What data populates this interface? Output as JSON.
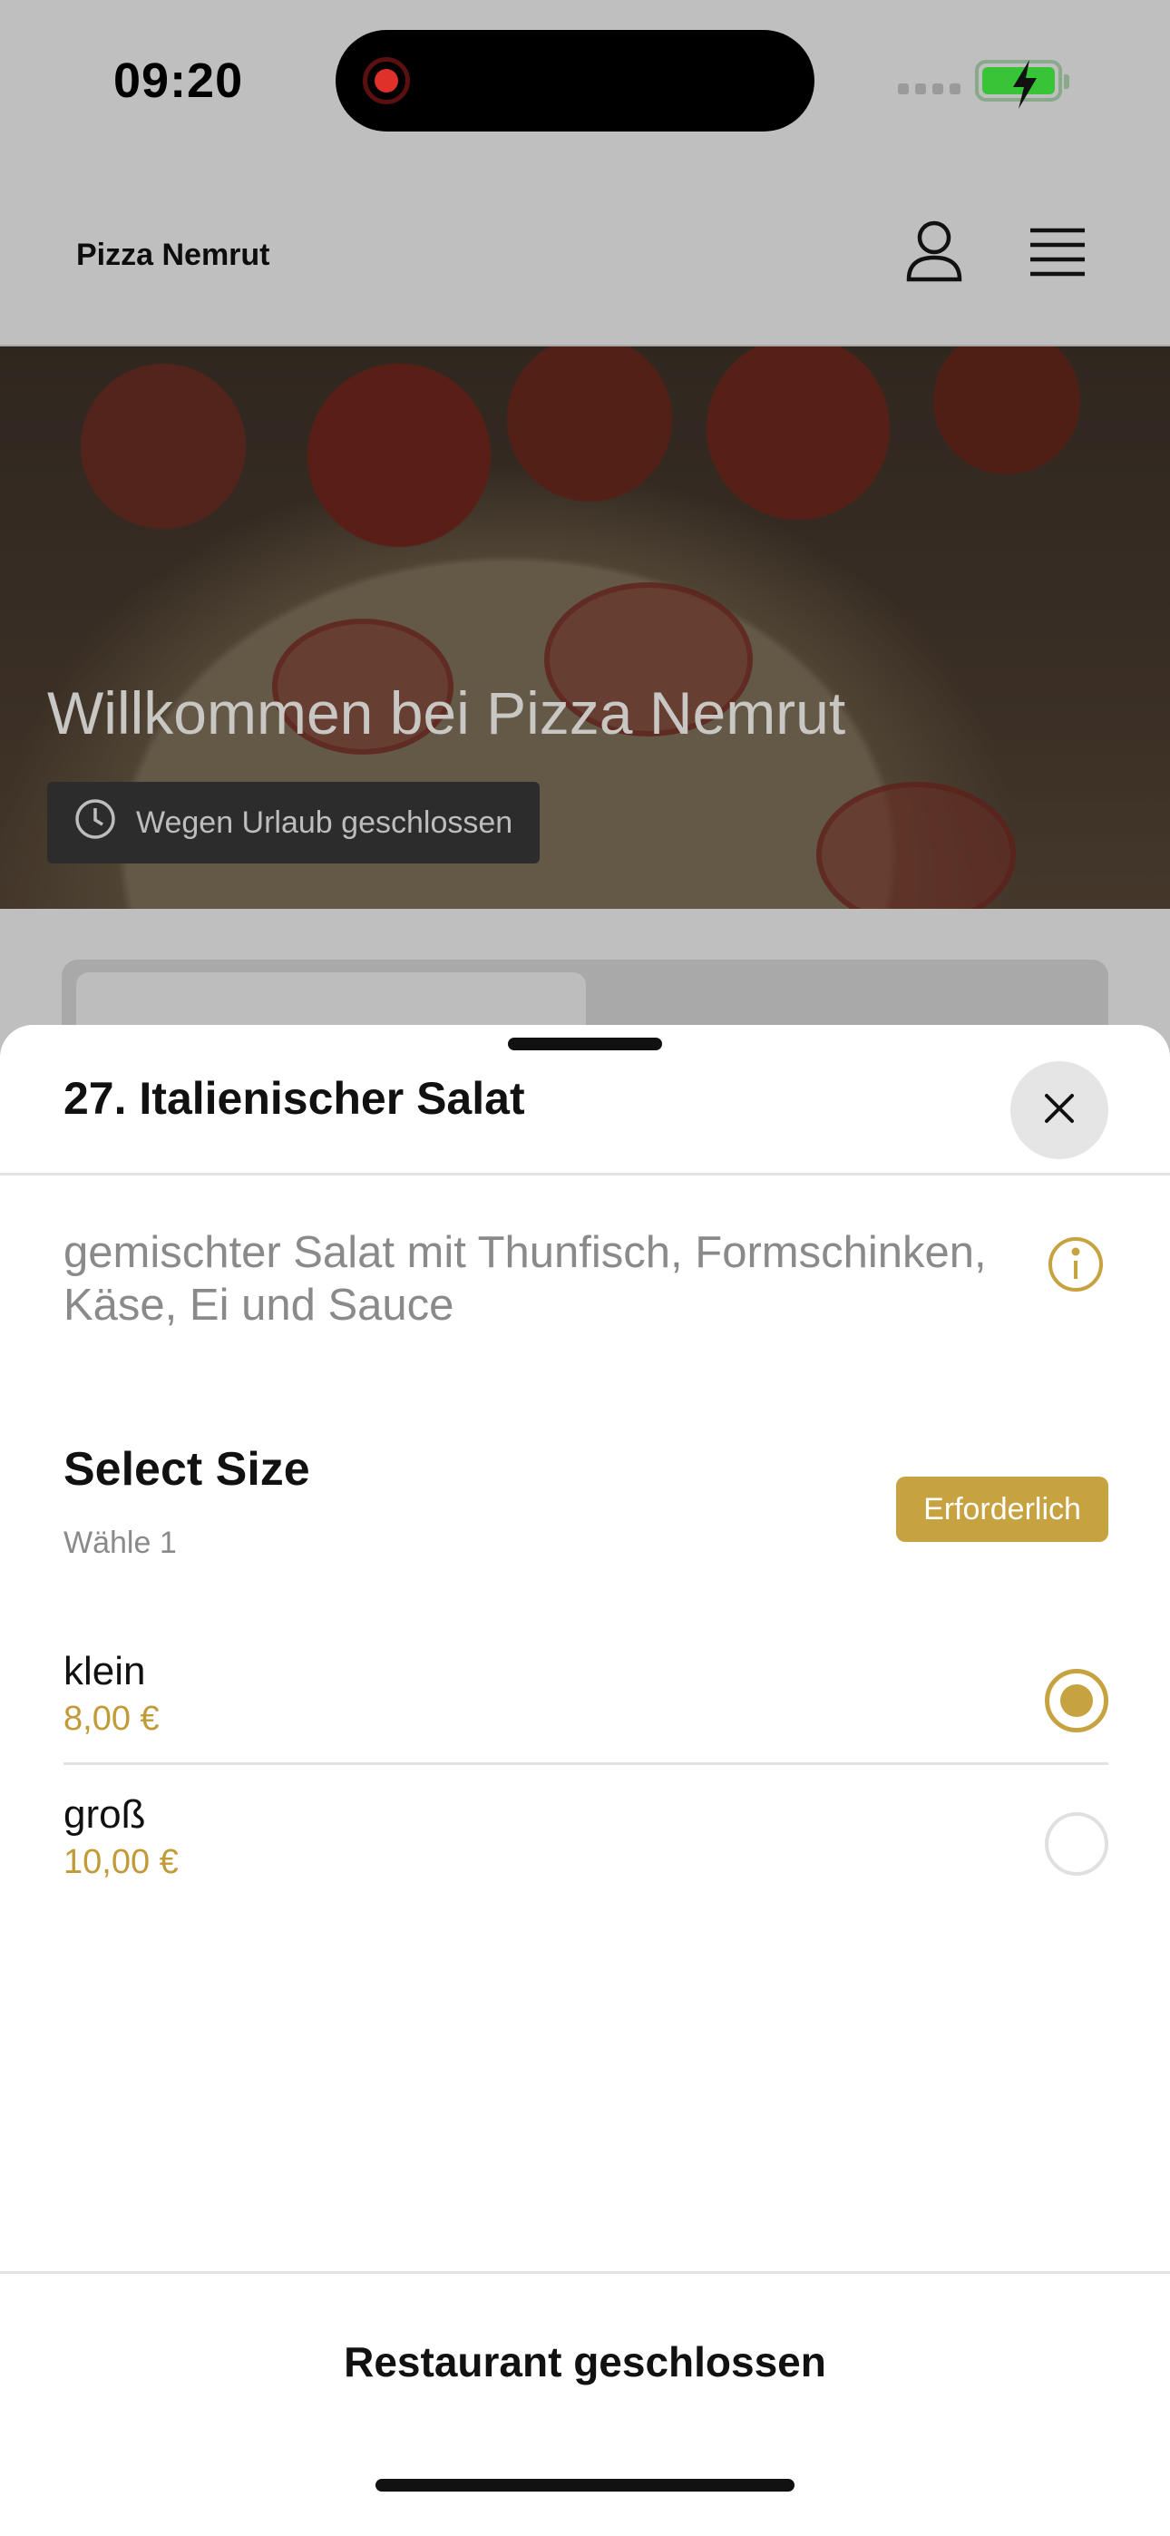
{
  "status_bar": {
    "time": "09:20"
  },
  "app_bar": {
    "brand": "Pizza Nemrut"
  },
  "hero": {
    "title": "Willkommen bei Pizza Nemrut",
    "status": "Wegen Urlaub geschlossen"
  },
  "sheet": {
    "title": "27. Italienischer Salat",
    "description": "gemischter Salat mit Thunfisch, Formschinken, Käse, Ei und Sauce",
    "group": {
      "title": "Select Size",
      "subtitle": "Wähle 1",
      "badge": "Erforderlich",
      "options": [
        {
          "name": "klein",
          "price": "8,00 €",
          "selected": true
        },
        {
          "name": "groß",
          "price": "10,00 €",
          "selected": false
        }
      ]
    },
    "footer_label": "Restaurant geschlossen"
  },
  "colors": {
    "accent": "#c6a240",
    "price": "#c09b38",
    "overlay": "#bfbfbf"
  },
  "icons": [
    "record-icon",
    "signal-icon",
    "battery-icon",
    "user-icon",
    "menu-icon",
    "clock-icon",
    "close-icon",
    "info-icon"
  ]
}
